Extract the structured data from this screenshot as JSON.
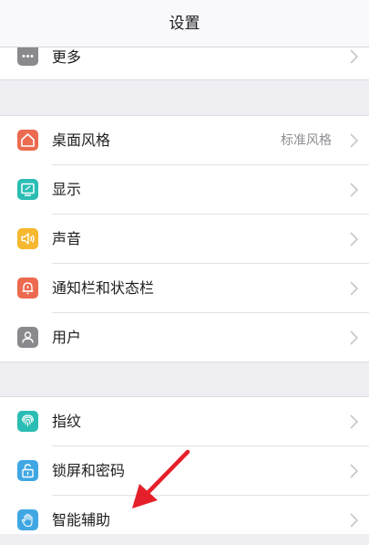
{
  "header": {
    "title": "设置"
  },
  "sections": {
    "top": [
      {
        "label": "更多",
        "icon": "more-icon",
        "color": "#8a8a8e"
      }
    ],
    "display": [
      {
        "label": "桌面风格",
        "value": "标准风格",
        "icon": "home-icon",
        "color": "#ec6a4f"
      },
      {
        "label": "显示",
        "icon": "display-icon",
        "color": "#2bbdb3"
      },
      {
        "label": "声音",
        "icon": "sound-icon",
        "color": "#f5b82e"
      },
      {
        "label": "通知栏和状态栏",
        "icon": "bell-icon",
        "color": "#ec6a4f"
      },
      {
        "label": "用户",
        "icon": "user-icon",
        "color": "#8a8a8e"
      }
    ],
    "security": [
      {
        "label": "指纹",
        "icon": "fingerprint-icon",
        "color": "#2bbdb3"
      },
      {
        "label": "锁屏和密码",
        "icon": "lock-icon",
        "color": "#40a7e3"
      },
      {
        "label": "智能辅助",
        "icon": "hand-icon",
        "color": "#40a7e3"
      }
    ]
  },
  "annotation": {
    "arrow_color": "#e5202b"
  }
}
